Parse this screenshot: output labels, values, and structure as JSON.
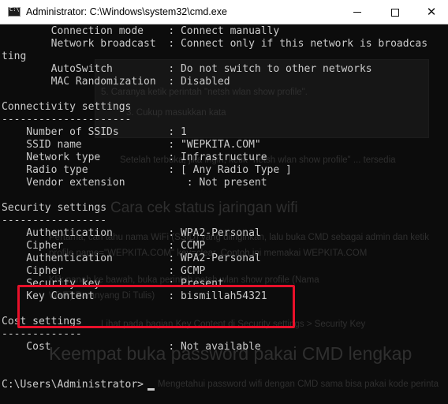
{
  "window": {
    "title": "Administrator: C:\\Windows\\system32\\cmd.exe",
    "app_icon": "cmd-icon",
    "controls": {
      "minimize": "minimize-icon",
      "maximize": "maximize-icon",
      "close": "close-icon",
      "close_glyph": "✕"
    }
  },
  "console": {
    "lines": [
      "        Connection mode    : Connect manually",
      "        Network broadcast  : Connect only if this network is broadcas",
      "ting",
      "        AutoSwitch         : Do not switch to other networks",
      "        MAC Randomization  : Disabled",
      "",
      "Connectivity settings",
      "---------------------",
      "    Number of SSIDs        : 1",
      "    SSID name              : \"WEPKITA.COM\"",
      "    Network type           : Infrastructure",
      "    Radio type             : [ Any Radio Type ]",
      "    Vendor extension          : Not present",
      "",
      "Security settings",
      "-----------------",
      "    Authentication         : WPA2-Personal",
      "    Cipher                 : CCMP",
      "    Authentication         : WPA2-Personal",
      "    Cipher                 : GCMP",
      "    Security key           : Present",
      "    Key Content            : bismillah54321",
      "",
      "Cost settings",
      "-------------",
      "    Cost                   : Not available",
      "",
      "",
      "C:\\Users\\Administrator>"
    ],
    "highlight_color": "#e8102a",
    "text_color": "#cccccc",
    "background_color": "#0c0c0c"
  },
  "background_page": {
    "texts": [
      "5. Caranya ketik perintah \"netsh wlan show profile\".",
      "3. Cukup masukkan kata",
      "Setelah terbuka, jika ingin, ketik \"netsh wlan show profile\" ... tersedia",
      "Cara cek status jaringan wifi",
      "Pertama, cari tahu nama WiFi (SSID) yang diinginkan, lalu buka CMD sebagai admin dan ketik",
      "profile name=\"WEPKITA.COM\" key=clear. Contoh ini memakai WEPKITA.COM",
      "Klik panah ke bawah, buka perintah netsh wlan show profile (Nama",
      "Wi-Fi) Paranyang Di Tulis)",
      "Lihat pada bagian Key Content di Security settings > Security Key",
      "Keempat buka password pakai CMD lengkap",
      "Mengetahui password wifi dengan CMD sama bisa pakai kode perintah"
    ]
  }
}
